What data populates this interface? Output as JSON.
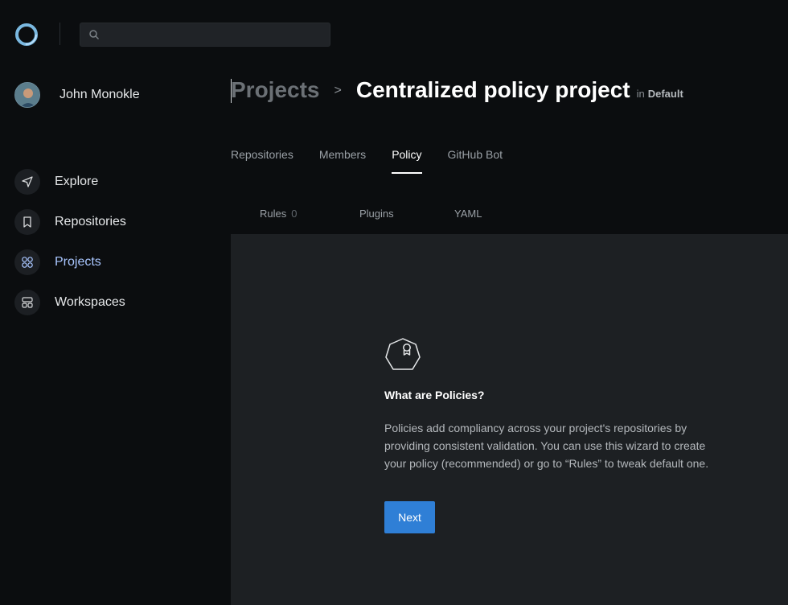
{
  "app": {
    "logo": "ring-logo-icon"
  },
  "search": {
    "placeholder": "",
    "value": "",
    "icon": "search-icon"
  },
  "user": {
    "name": "John Monokle",
    "avatar": "avatar-photo"
  },
  "sidebar": {
    "items": [
      {
        "label": "Explore",
        "icon": "paper-plane-icon",
        "active": false
      },
      {
        "label": "Repositories",
        "icon": "bookmark-icon",
        "active": false
      },
      {
        "label": "Projects",
        "icon": "grid-circles-icon",
        "active": true
      },
      {
        "label": "Workspaces",
        "icon": "workspaces-icon",
        "active": false
      }
    ]
  },
  "breadcrumb": {
    "parent": "Projects",
    "separator": ">",
    "title": "Centralized policy project",
    "in_label": "in",
    "workspace": "Default"
  },
  "tabs": [
    {
      "label": "Repositories",
      "active": false
    },
    {
      "label": "Members",
      "active": false
    },
    {
      "label": "Policy",
      "active": true
    },
    {
      "label": "GitHub Bot",
      "active": false
    }
  ],
  "subtabs": [
    {
      "label": "Rules",
      "count": "0"
    },
    {
      "label": "Plugins"
    },
    {
      "label": "YAML"
    }
  ],
  "empty_state": {
    "icon": "policy-badge-icon",
    "title": "What are Policies?",
    "description": "Policies add compliancy across your project's repositories by providing consistent validation. You can use this wizard to create your policy (recommended) or go to “Rules” to tweak default one.",
    "button": "Next"
  },
  "colors": {
    "background": "#0b0d0f",
    "panel": "#1d2023",
    "accent": "#2f7fd6",
    "active_nav": "#a9c6ff"
  }
}
